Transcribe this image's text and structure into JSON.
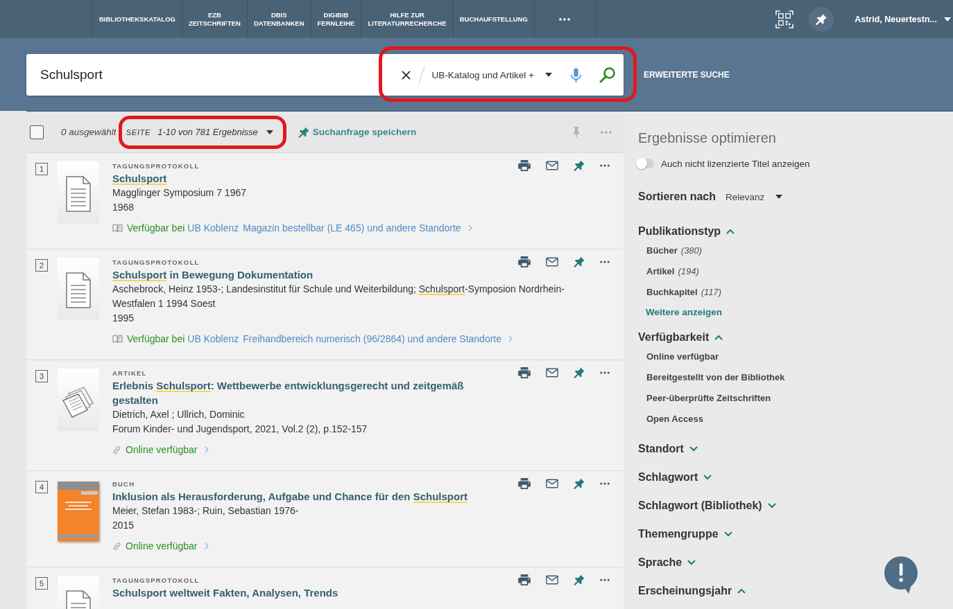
{
  "nav": {
    "items": [
      {
        "label": "BIBLIOTHEKSKATALOG",
        "selected": false
      },
      {
        "label": "EZB\nZEITSCHRIFTEN",
        "selected": false
      },
      {
        "label": "DBIS\nDATENBANKEN",
        "selected": false
      },
      {
        "label": "DIGIBIB\nFERNLEIHE",
        "selected": false
      },
      {
        "label": "HILFE ZUR\nLITERATURRECHERCHE",
        "selected": false
      },
      {
        "label": "BUCHAUFSTELLUNG",
        "selected": false
      }
    ],
    "user": "Astrid, Neuertestn..."
  },
  "search": {
    "value": "Schulsport",
    "scope": "UB-Katalog und Artikel +",
    "highlighted": true,
    "advanced_link": "ERWEITERTE SUCHE"
  },
  "results_bar": {
    "checked": false,
    "selection": "0 ausgewählt",
    "page_label": "SEITE",
    "page_range": "1-10 von 781 Ergebnisse",
    "highlighted": true,
    "save_query": "Suchanfrage speichern"
  },
  "results": [
    {
      "number": "1",
      "thumbnail": {
        "kind": "document"
      },
      "type": "TAGUNGSPROTOKOLL",
      "title": [
        {
          "text": "Schulsport",
          "highlighted": true
        }
      ],
      "details": [
        [
          {
            "text": "Magglinger Symposium 7 1967",
            "highlighted": false
          }
        ],
        [
          {
            "text": "1968",
            "highlighted": false
          }
        ]
      ],
      "availability": {
        "kind": "physical",
        "status": "Verfügbar bei",
        "library": "UB Koblenz",
        "location": "Magazin bestellbar (LE 465) und andere Standorte"
      }
    },
    {
      "number": "2",
      "thumbnail": {
        "kind": "document"
      },
      "type": "TAGUNGSPROTOKOLL",
      "title": [
        {
          "text": "Schulsport",
          "highlighted": true
        },
        {
          "text": " in Bewegung Dokumentation",
          "highlighted": false
        }
      ],
      "details": [
        [
          {
            "text": "Aschebrock, Heinz 1953-; Landesinstitut für Schule und Weiterbildung; ",
            "highlighted": false
          },
          {
            "text": "Schulsport",
            "highlighted": true
          },
          {
            "text": "-Symposion Nordrhein-Westfalen 1 1994 Soest",
            "highlighted": false
          }
        ],
        [
          {
            "text": "1995",
            "highlighted": false
          }
        ]
      ],
      "availability": {
        "kind": "physical",
        "status": "Verfügbar bei",
        "library": "UB Koblenz",
        "location": "Freihandbereich numerisch (96/2864) und andere Standorte"
      }
    },
    {
      "number": "3",
      "thumbnail": {
        "kind": "article"
      },
      "type": "ARTIKEL",
      "title": [
        {
          "text": "Erlebnis ",
          "highlighted": false
        },
        {
          "text": "Schulsport",
          "highlighted": true
        },
        {
          "text": ": Wettbewerbe entwicklungsgerecht und zeitgemäß gestalten",
          "highlighted": false
        }
      ],
      "details": [
        [
          {
            "text": "Dietrich, Axel ; Ullrich, Dominic",
            "highlighted": false
          }
        ],
        [
          {
            "text": "Forum Kinder- und Jugendsport, 2021, Vol.2 (2), p.152-157",
            "highlighted": false
          }
        ]
      ],
      "availability": {
        "kind": "online",
        "status": "Online verfügbar"
      }
    },
    {
      "number": "4",
      "thumbnail": {
        "kind": "cover"
      },
      "type": "BUCH",
      "title": [
        {
          "text": "Inklusion als Herausforderung, Aufgabe und Chance für den ",
          "highlighted": false
        },
        {
          "text": "Schulsport",
          "highlighted": true
        }
      ],
      "details": [
        [
          {
            "text": "Meier, Stefan 1983-; Ruin, Sebastian 1976-",
            "highlighted": false
          }
        ],
        [
          {
            "text": "2015",
            "highlighted": false
          }
        ]
      ],
      "availability": {
        "kind": "online",
        "status": "Online verfügbar"
      }
    },
    {
      "number": "5",
      "thumbnail": {
        "kind": "document"
      },
      "type": "TAGUNGSPROTOKOLL",
      "title": [
        {
          "text": "Schulsport weltweit Fakten, Analysen, Trends",
          "highlighted": false
        }
      ]
    }
  ],
  "sidebar": {
    "title": "Ergebnisse optimieren",
    "toggle": {
      "label": "Auch nicht lizenzierte Titel anzeigen",
      "on": false
    },
    "sort": {
      "label": "Sortieren nach",
      "value": "Relevanz"
    },
    "facets": [
      {
        "name": "Publikationstyp",
        "expanded": true,
        "items": [
          {
            "label": "Bücher",
            "count": "(380)"
          },
          {
            "label": "Artikel",
            "count": "(194)"
          },
          {
            "label": "Buchkapitel",
            "count": "(117)"
          }
        ],
        "more": "Weitere anzeigen"
      },
      {
        "name": "Verfügbarkeit",
        "expanded": true,
        "items": [
          {
            "label": "Online verfügbar"
          },
          {
            "label": "Bereitgestellt von der Bibliothek"
          },
          {
            "label": "Peer-überprüfte Zeitschriften"
          },
          {
            "label": "Open Access"
          }
        ]
      },
      {
        "name": "Standort",
        "expanded": false
      },
      {
        "name": "Schlagwort",
        "expanded": false
      },
      {
        "name": "Schlagwort (Bibliothek)",
        "expanded": false
      },
      {
        "name": "Themengruppe",
        "expanded": false
      },
      {
        "name": "Sprache",
        "expanded": false
      },
      {
        "name": "Erscheinungsjahr",
        "expanded": true
      }
    ]
  }
}
